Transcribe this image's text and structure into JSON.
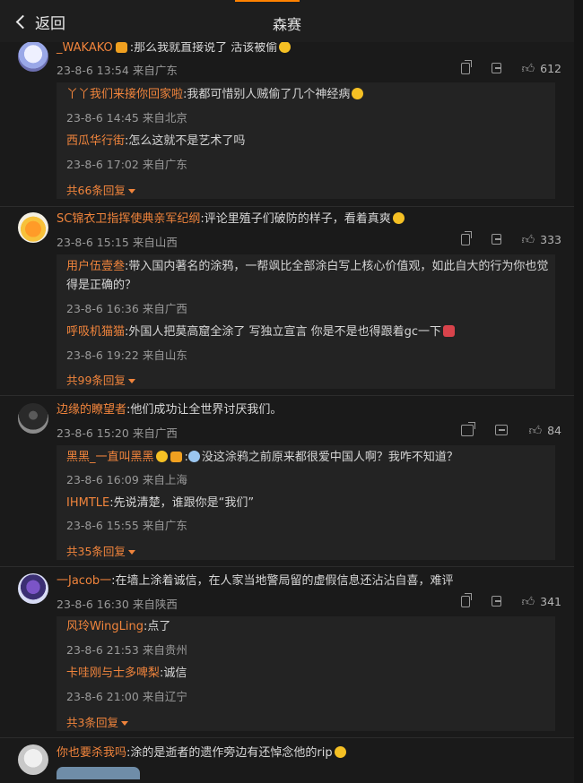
{
  "header": {
    "back_label": "返回",
    "title": "森赛"
  },
  "comments": [
    {
      "user": "_WAKAKO",
      "text": ":那么我就直接说了 活该被偷",
      "time": "23-8-6 13:54",
      "location": "来自广东",
      "likes": "612",
      "replies": [
        {
          "user": "丫丫我们来接你回家啦",
          "text": ":我都可惜别人贼偷了几个神经病",
          "time": "23-8-6 14:45",
          "location": "来自北京"
        },
        {
          "user": "西瓜华行街",
          "text": ":怎么这就不是艺术了吗",
          "time": "23-8-6 17:02",
          "location": "来自广东"
        }
      ],
      "more": "共66条回复"
    },
    {
      "user": "SC锦衣卫指挥使典亲军纪纲",
      "text": ":评论里殖子们破防的样子，看着真爽",
      "time": "23-8-6 15:15",
      "location": "来自山西",
      "likes": "333",
      "replies": [
        {
          "user": "用户伍壹叁",
          "text": ":带入国内著名的涂鸦，一帮飒比全部涂白写上核心价值观，如此自大的行为你也觉",
          "text2": "得是正确的？",
          "time": "23-8-6 16:36",
          "location": "来自广西"
        },
        {
          "user": "呼吸机猫猫",
          "text": ":外国人把莫高窟全涂了 写独立宣言 你是不是也得跟着gc一下",
          "time": "23-8-6 19:22",
          "location": "来自山东"
        }
      ],
      "more": "共99条回复"
    },
    {
      "user": "边缘的瞭望者",
      "text": ":他们成功让全世界讨厌我们。",
      "time": "23-8-6 15:20",
      "location": "来自广西",
      "likes": "84",
      "replies": [
        {
          "user": "黑黑_一直叫黑黑",
          "text": "没这涂鸦之前原来都很爱中国人啊？我咋不知道？",
          "time": "23-8-6 16:09",
          "location": "来自上海"
        },
        {
          "user": "IHMTLE",
          "text": ":先说清楚，谁跟你是“我们”",
          "time": "23-8-6 15:55",
          "location": "来自广东"
        }
      ],
      "more": "共35条回复"
    },
    {
      "user": "一Jacob一",
      "text": ":在墙上涂着诚信，在人家当地警局留的虚假信息还沾沾自喜，难评",
      "time": "23-8-6 16:30",
      "location": "来自陕西",
      "likes": "341",
      "replies": [
        {
          "user": "风玲WingLing",
          "text": ":点了",
          "time": "23-8-6 21:53",
          "location": "来自贵州"
        },
        {
          "user": "卡哇刚与士多啤梨",
          "text": ":诚信",
          "time": "23-8-6 21:00",
          "location": "来自辽宁"
        }
      ],
      "more": "共3条回复"
    },
    {
      "user": "你也要杀我吗",
      "text": ":涂的是逝者的遗作旁边有还悼念他的rip"
    }
  ],
  "colors": {
    "accent": "#f0843c",
    "background": "#1a1a1a",
    "reply_background": "#232323"
  },
  "icons": {
    "share": "share-icon",
    "comment": "comment-icon",
    "like": "thumbs-up-icon",
    "back": "chevron-left-icon"
  }
}
